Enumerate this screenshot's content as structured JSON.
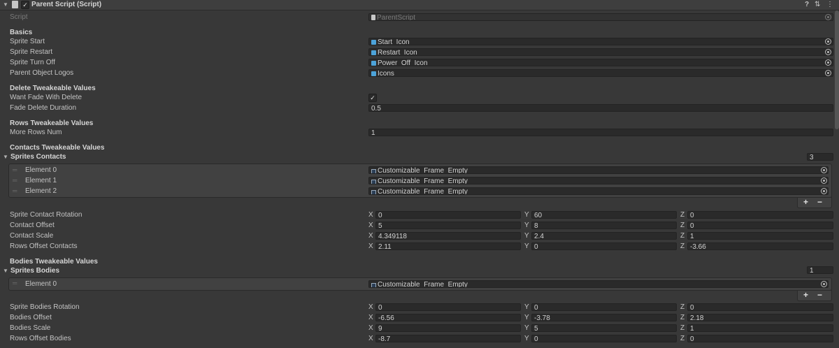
{
  "header": {
    "title": "Parent Script (Script)",
    "enabled": true
  },
  "script_row": {
    "label": "Script",
    "value": "ParentScript"
  },
  "basics": {
    "title": "Basics",
    "rows": [
      {
        "label": "Sprite Start",
        "value": "Start_Icon"
      },
      {
        "label": "Sprite Restart",
        "value": "Restart_Icon"
      },
      {
        "label": "Sprite Turn Off",
        "value": "Power_Off_Icon"
      },
      {
        "label": "Parent Object Logos",
        "value": "Icons"
      }
    ]
  },
  "delete": {
    "title": "Delete Tweakeable Values",
    "want_fade_label": "Want Fade With Delete",
    "want_fade_checked": true,
    "fade_duration_label": "Fade Delete Duration",
    "fade_duration_value": "0.5"
  },
  "rows_section": {
    "title": "Rows Tweakeable Values",
    "more_rows_label": "More Rows Num",
    "more_rows_value": "1"
  },
  "contacts": {
    "title": "Contacts Tweakeable Values",
    "list_label": "Sprites Contacts",
    "list_size": "3",
    "elements": [
      {
        "label": "Element 0",
        "value": "Customizable_Frame_Empty"
      },
      {
        "label": "Element 1",
        "value": "Customizable_Frame_Empty"
      },
      {
        "label": "Element 2",
        "value": "Customizable_Frame_Empty"
      }
    ],
    "vectors": [
      {
        "label": "Sprite Contact Rotation",
        "x": "0",
        "y": "60",
        "z": "0"
      },
      {
        "label": "Contact Offset",
        "x": "5",
        "y": "8",
        "z": "0"
      },
      {
        "label": "Contact Scale",
        "x": "4.349118",
        "y": "2.4",
        "z": "1"
      },
      {
        "label": "Rows Offset Contacts",
        "x": "2.11",
        "y": "0",
        "z": "-3.66"
      }
    ]
  },
  "bodies": {
    "title": "Bodies Tweakeable Values",
    "list_label": "Sprites Bodies",
    "list_size": "1",
    "elements": [
      {
        "label": "Element 0",
        "value": "Customizable_Frame_Empty"
      }
    ],
    "vectors": [
      {
        "label": "Sprite Bodies Rotation",
        "x": "0",
        "y": "0",
        "z": "0"
      },
      {
        "label": "Bodies Offset",
        "x": "-6.56",
        "y": "-3.78",
        "z": "2.18"
      },
      {
        "label": "Bodies Scale",
        "x": "9",
        "y": "5",
        "z": "1"
      },
      {
        "label": "Rows Offset Bodies",
        "x": "-8.7",
        "y": "0",
        "z": "0"
      }
    ]
  },
  "axes": {
    "x": "X",
    "y": "Y",
    "z": "Z"
  },
  "list_buttons": {
    "add": "+",
    "remove": "−"
  },
  "glyphs": {
    "arrow_down": "▼",
    "check": "✓",
    "help": "?",
    "settings": "⇅",
    "menu": "⋮",
    "handle": "═"
  }
}
